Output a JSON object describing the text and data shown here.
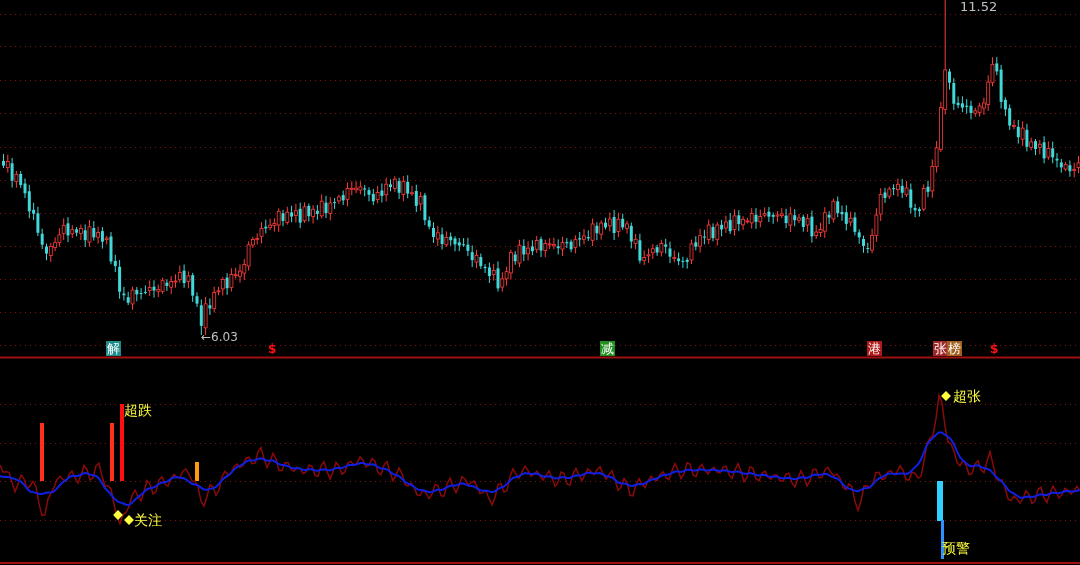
{
  "price_chart": {
    "high_label": "11.52",
    "low_label": "←6.03"
  },
  "event_markers": [
    {
      "kind": "tag",
      "text": "解",
      "color": "#1e8c8c"
    },
    {
      "kind": "dollar",
      "text": "$",
      "color": "#ff1010"
    },
    {
      "kind": "tag",
      "text": "减",
      "color": "#1f8f1f"
    },
    {
      "kind": "tag",
      "text": "港",
      "color": "#b01818"
    },
    {
      "kind": "tag",
      "text": "张",
      "color": "#a02828"
    },
    {
      "kind": "tag",
      "text": "榜",
      "color": "#a0601e"
    },
    {
      "kind": "dollar",
      "text": "$",
      "color": "#ff1010"
    }
  ],
  "indicator": {
    "labels": [
      {
        "kind": "plain",
        "text": "超跌"
      },
      {
        "kind": "diamond",
        "text": "关注"
      },
      {
        "kind": "diamond",
        "text": "超张"
      },
      {
        "kind": "plain",
        "text": "预警"
      }
    ]
  }
}
